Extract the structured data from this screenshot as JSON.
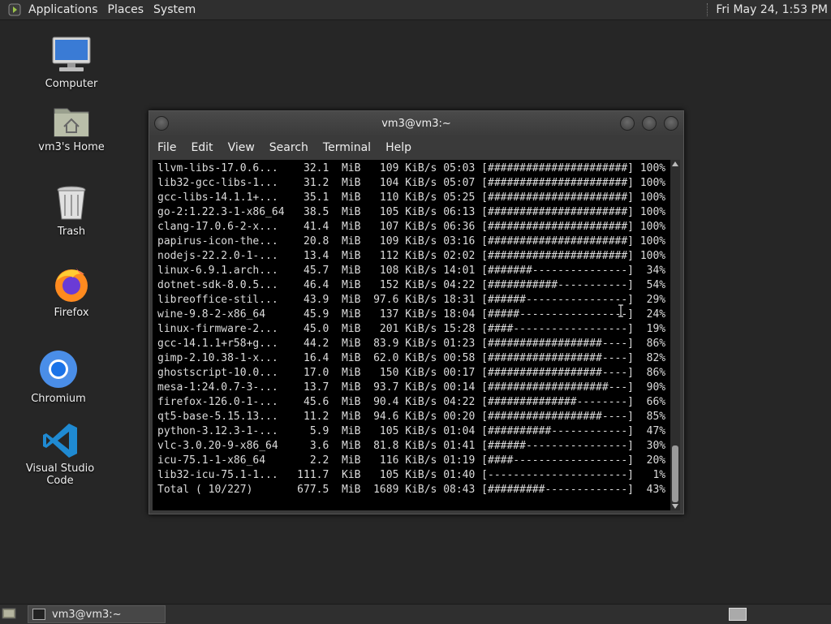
{
  "top_panel": {
    "menus": [
      "Applications",
      "Places",
      "System"
    ],
    "clock": "Fri May 24,  1:53 PM"
  },
  "desktop_icons": [
    {
      "label": "Computer",
      "icon": "computer-icon"
    },
    {
      "label": "vm3's Home",
      "icon": "home-folder-icon"
    },
    {
      "label": "Trash",
      "icon": "trash-icon"
    },
    {
      "label": "Firefox",
      "icon": "firefox-icon"
    },
    {
      "label": "Chromium",
      "icon": "chromium-icon"
    },
    {
      "label": "Visual Studio Code",
      "icon": "vscode-icon"
    }
  ],
  "terminal": {
    "title": "vm3@vm3:~",
    "menu": [
      "File",
      "Edit",
      "View",
      "Search",
      "Terminal",
      "Help"
    ],
    "lines": [
      "llvm-libs-17.0.6...    32.1  MiB   109 KiB/s 05:03 [######################] 100%",
      "lib32-gcc-libs-1...    31.2  MiB   104 KiB/s 05:07 [######################] 100%",
      "gcc-libs-14.1.1+...    35.1  MiB   110 KiB/s 05:25 [######################] 100%",
      "go-2:1.22.3-1-x86_64   38.5  MiB   105 KiB/s 06:13 [######################] 100%",
      "clang-17.0.6-2-x...    41.4  MiB   107 KiB/s 06:36 [######################] 100%",
      "papirus-icon-the...    20.8  MiB   109 KiB/s 03:16 [######################] 100%",
      "nodejs-22.2.0-1-...    13.4  MiB   112 KiB/s 02:02 [######################] 100%",
      "linux-6.9.1.arch...    45.7  MiB   108 KiB/s 14:01 [#######---------------]  34%",
      "dotnet-sdk-8.0.5...    46.4  MiB   152 KiB/s 04:22 [###########-----------]  54%",
      "libreoffice-stil...    43.9  MiB  97.6 KiB/s 18:31 [######----------------]  29%",
      "wine-9.8-2-x86_64      45.9  MiB   137 KiB/s 18:04 [#####-----------------]  24%",
      "linux-firmware-2...    45.0  MiB   201 KiB/s 15:28 [####------------------]  19%",
      "gcc-14.1.1+r58+g...    44.2  MiB  83.9 KiB/s 01:23 [##################----]  86%",
      "gimp-2.10.38-1-x...    16.4  MiB  62.0 KiB/s 00:58 [##################----]  82%",
      "ghostscript-10.0...    17.0  MiB   150 KiB/s 00:17 [##################----]  86%",
      "mesa-1:24.0.7-3-...    13.7  MiB  93.7 KiB/s 00:14 [###################---]  90%",
      "firefox-126.0-1-...    45.6  MiB  90.4 KiB/s 04:22 [##############--------]  66%",
      "qt5-base-5.15.13...    11.2  MiB  94.6 KiB/s 00:20 [##################----]  85%",
      "python-3.12.3-1-...     5.9  MiB   105 KiB/s 01:04 [##########------------]  47%",
      "vlc-3.0.20-9-x86_64     3.6  MiB  81.8 KiB/s 01:41 [######----------------]  30%",
      "icu-75.1-1-x86_64       2.2  MiB   116 KiB/s 01:19 [####------------------]  20%",
      "lib32-icu-75.1-1...   111.7  KiB   105 KiB/s 01:40 [----------------------]   1%",
      "Total ( 10/227)       677.5  MiB  1689 KiB/s 08:43 [#########-------------]  43%"
    ]
  },
  "taskbar": {
    "items": [
      {
        "label": "vm3@vm3:~"
      }
    ]
  }
}
